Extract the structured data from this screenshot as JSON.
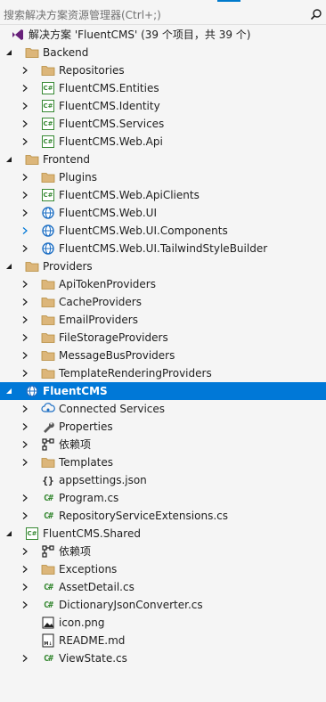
{
  "search": {
    "placeholder": "搜索解决方案资源管理器(Ctrl+;)",
    "icon": "search-icon"
  },
  "tree": [
    {
      "level": 0,
      "expander": "none",
      "icon": "vs-solution",
      "label": "解决方案 'FluentCMS' (39 个项目，共 39 个)"
    },
    {
      "level": 1,
      "expander": "expanded",
      "icon": "folder",
      "label": "Backend"
    },
    {
      "level": 2,
      "expander": "collapsed",
      "icon": "folder",
      "label": "Repositories"
    },
    {
      "level": 2,
      "expander": "collapsed",
      "icon": "csproj",
      "label": "FluentCMS.Entities"
    },
    {
      "level": 2,
      "expander": "collapsed",
      "icon": "csproj",
      "label": "FluentCMS.Identity"
    },
    {
      "level": 2,
      "expander": "collapsed",
      "icon": "csproj",
      "label": "FluentCMS.Services"
    },
    {
      "level": 2,
      "expander": "collapsed",
      "icon": "csproj",
      "label": "FluentCMS.Web.Api"
    },
    {
      "level": 1,
      "expander": "expanded",
      "icon": "folder",
      "label": "Frontend"
    },
    {
      "level": 2,
      "expander": "collapsed",
      "icon": "folder",
      "label": "Plugins"
    },
    {
      "level": 2,
      "expander": "collapsed",
      "icon": "csproj",
      "label": "FluentCMS.Web.ApiClients"
    },
    {
      "level": 2,
      "expander": "collapsed",
      "icon": "webproj",
      "label": "FluentCMS.Web.UI"
    },
    {
      "level": 2,
      "expander": "collapsed-blue",
      "icon": "webproj",
      "label": "FluentCMS.Web.UI.Components"
    },
    {
      "level": 2,
      "expander": "collapsed",
      "icon": "webproj",
      "label": "FluentCMS.Web.UI.TailwindStyleBuilder"
    },
    {
      "level": 1,
      "expander": "expanded",
      "icon": "folder",
      "label": "Providers"
    },
    {
      "level": 2,
      "expander": "collapsed",
      "icon": "folder",
      "label": "ApiTokenProviders"
    },
    {
      "level": 2,
      "expander": "collapsed",
      "icon": "folder",
      "label": "CacheProviders"
    },
    {
      "level": 2,
      "expander": "collapsed",
      "icon": "folder",
      "label": "EmailProviders"
    },
    {
      "level": 2,
      "expander": "collapsed",
      "icon": "folder",
      "label": "FileStorageProviders"
    },
    {
      "level": 2,
      "expander": "collapsed",
      "icon": "folder",
      "label": "MessageBusProviders"
    },
    {
      "level": 2,
      "expander": "collapsed",
      "icon": "folder",
      "label": "TemplateRenderingProviders"
    },
    {
      "level": 1,
      "expander": "expanded",
      "icon": "webproj",
      "label": "FluentCMS",
      "selected": true
    },
    {
      "level": 2,
      "expander": "collapsed",
      "icon": "connected",
      "label": "Connected Services"
    },
    {
      "level": 2,
      "expander": "collapsed",
      "icon": "wrench",
      "label": "Properties"
    },
    {
      "level": 2,
      "expander": "collapsed",
      "icon": "deps",
      "label": "依赖项"
    },
    {
      "level": 2,
      "expander": "collapsed",
      "icon": "folder",
      "label": "Templates"
    },
    {
      "level": 2,
      "expander": "none",
      "icon": "json",
      "label": "appsettings.json"
    },
    {
      "level": 2,
      "expander": "collapsed",
      "icon": "cs",
      "label": "Program.cs"
    },
    {
      "level": 2,
      "expander": "collapsed",
      "icon": "cs",
      "label": "RepositoryServiceExtensions.cs"
    },
    {
      "level": 1,
      "expander": "expanded",
      "icon": "csproj",
      "label": "FluentCMS.Shared"
    },
    {
      "level": 2,
      "expander": "collapsed",
      "icon": "deps",
      "label": "依赖项"
    },
    {
      "level": 2,
      "expander": "collapsed",
      "icon": "folder",
      "label": "Exceptions"
    },
    {
      "level": 2,
      "expander": "collapsed",
      "icon": "cs",
      "label": "AssetDetail.cs"
    },
    {
      "level": 2,
      "expander": "collapsed",
      "icon": "cs",
      "label": "DictionaryJsonConverter.cs"
    },
    {
      "level": 2,
      "expander": "none",
      "icon": "image",
      "label": "icon.png"
    },
    {
      "level": 2,
      "expander": "none",
      "icon": "markdown",
      "label": "README.md"
    },
    {
      "level": 2,
      "expander": "collapsed",
      "icon": "cs",
      "label": "ViewState.cs"
    }
  ],
  "colors": {
    "selection": "#0078d7",
    "folder": "#dcb67a",
    "csharp": "#368832",
    "web": "#1e6fc4",
    "background": "#f5f5f5"
  }
}
